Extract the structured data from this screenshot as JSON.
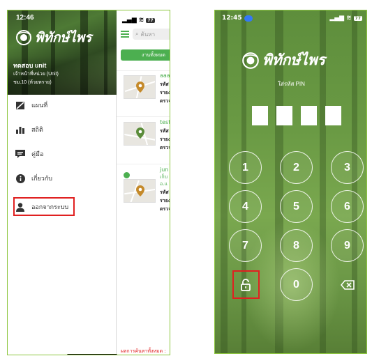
{
  "left_phone": {
    "status_time": "12:46",
    "app_name": "พิทักษ์ไพร",
    "user": {
      "name": "ทดสอบ unit",
      "role": "เจ้าหน้าที่หน่วย (Unit)",
      "unit": "ชม.10 (ห้วยทราย)"
    },
    "menu": [
      {
        "icon": "map-off-icon",
        "label": "แผนที่"
      },
      {
        "icon": "bar-chart-icon",
        "label": "สถิติ"
      },
      {
        "icon": "manual-icon",
        "label": "คู่มือ"
      },
      {
        "icon": "info-icon",
        "label": "เกี่ยวกับ"
      },
      {
        "icon": "user-icon",
        "label": "ออกจากระบบ"
      }
    ],
    "list": {
      "battery": "77",
      "search_placeholder": "ค้นหา",
      "tab_all": "งานทั้งหมด",
      "cases": [
        {
          "title": "aaa",
          "lines": [
            "รหัส",
            "รายง",
            "ตรวจ"
          ],
          "pin_color": "#c58a2a"
        },
        {
          "title": "test",
          "lines": [
            "รหัส",
            "รายง",
            "ตรวจ"
          ],
          "pin_color": "#5b8c3a"
        },
        {
          "title": "jun",
          "lines": [
            "เก็บ",
            "อ.แ",
            "รหัส",
            "รายง",
            "ตรวจ"
          ],
          "pin_color": "#c58a2a"
        }
      ],
      "results_text": "ผลการค้นหาทั้งหมด :"
    }
  },
  "right_phone": {
    "status_time": "12:45",
    "battery": "77",
    "app_name": "พิทักษ์ไพร",
    "pin_prompt": "ใส่รหัส PIN",
    "keys": [
      "1",
      "2",
      "3",
      "4",
      "5",
      "6",
      "7",
      "8",
      "9",
      "0"
    ]
  }
}
